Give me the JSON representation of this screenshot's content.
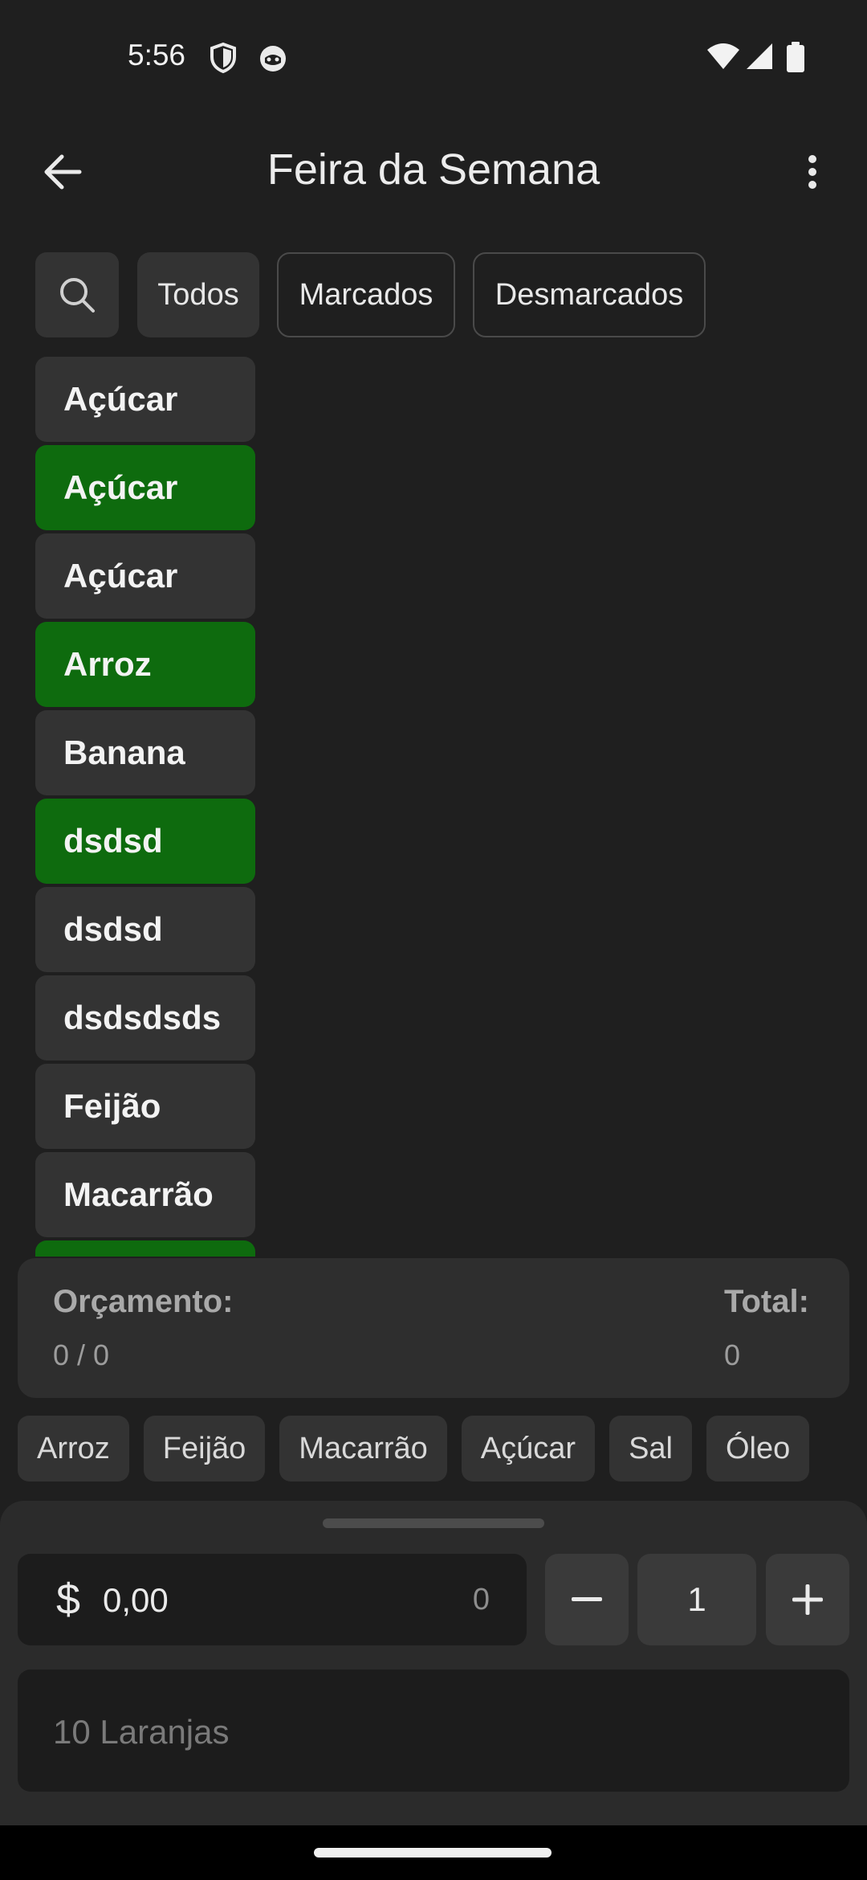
{
  "status_bar": {
    "time": "5:56",
    "icons": [
      "shield-icon",
      "mascot-icon",
      "wifi-icon",
      "signal-icon",
      "battery-icon"
    ]
  },
  "app_bar": {
    "title": "Feira da Semana",
    "back_icon": "arrow-left-icon",
    "menu_icon": "more-vert-icon"
  },
  "filters": {
    "search_icon": "search-icon",
    "chips": [
      {
        "label": "Todos",
        "selected": true
      },
      {
        "label": "Marcados",
        "selected": false
      },
      {
        "label": "Desmarcados",
        "selected": false
      }
    ]
  },
  "products": [
    {
      "name": "Açúcar",
      "checked": false
    },
    {
      "name": "Açúcar",
      "checked": true
    },
    {
      "name": "Açúcar",
      "checked": false
    },
    {
      "name": "Arroz",
      "checked": true
    },
    {
      "name": "Banana",
      "checked": false
    },
    {
      "name": "dsdsd",
      "checked": true
    },
    {
      "name": "dsdsd",
      "checked": false
    },
    {
      "name": "dsdsdsds",
      "checked": false
    },
    {
      "name": "Feijão",
      "checked": false
    },
    {
      "name": "Macarrão",
      "checked": false
    },
    {
      "name": "",
      "checked": true
    }
  ],
  "summary": {
    "budget_label": "Orçamento:",
    "budget_value": "0 / 0",
    "total_label": "Total:",
    "total_value": "0"
  },
  "suggestions": [
    "Arroz",
    "Feijão",
    "Macarrão",
    "Açúcar",
    "Sal",
    "Óleo"
  ],
  "entry": {
    "currency": "$",
    "price": "0,00",
    "price_count": "0",
    "minus_icon": "minus-icon",
    "quantity": "1",
    "plus_icon": "plus-icon",
    "name_placeholder": "10 Laranjas"
  },
  "colors": {
    "background": "#1f1f1f",
    "surface": "#333333",
    "checked": "#0e6b0e",
    "sheet": "#2b2b2b",
    "field": "#1c1c1c"
  }
}
